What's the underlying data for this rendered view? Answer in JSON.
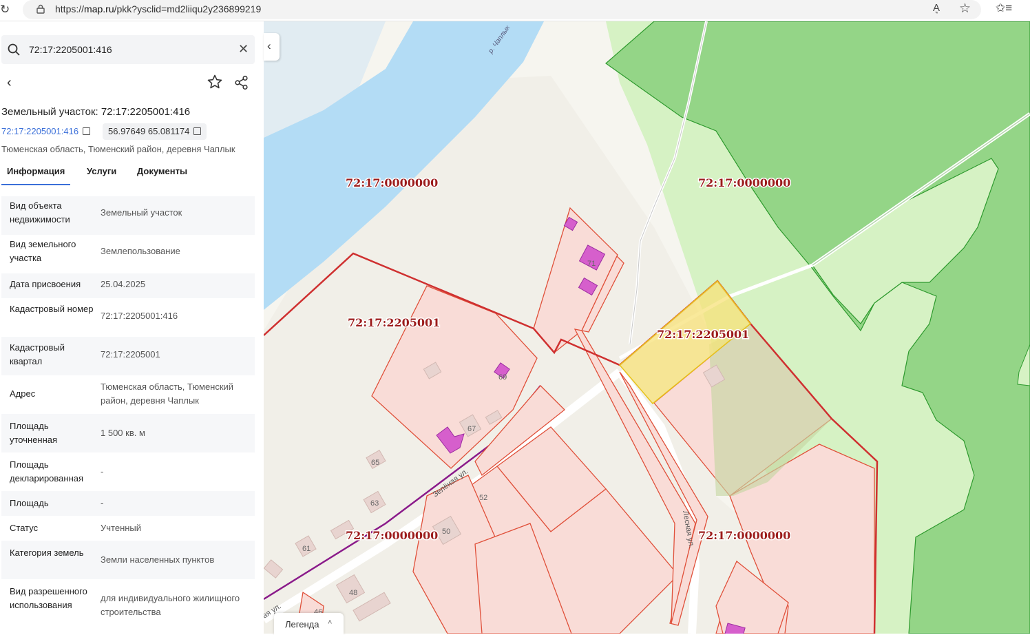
{
  "browser": {
    "url_scheme": "https://",
    "url_host": "map.ru",
    "url_path": "/pkk?ysclid=md2liiqu2y236899219",
    "read_aloud": "A͉",
    "favorite_icon": "☆",
    "favorites_icon": "✩≡"
  },
  "search": {
    "value": "72:17:2205001:416",
    "clear_icon": "✕"
  },
  "panel": {
    "back_icon": "‹",
    "title": "Земельный участок: 72:17:2205001:416",
    "cad_link": "72:17:2205001:416",
    "coords": "56.97649 65.081174",
    "address": "Тюменская область, Тюменский район, деревня Чаплык"
  },
  "tabs": [
    "Информация",
    "Услуги",
    "Документы"
  ],
  "rows": [
    {
      "label": "Вид объекта недвижимости",
      "value": "Земельный участок"
    },
    {
      "label": "Вид земельного участка",
      "value": "Землепользование"
    },
    {
      "label": "Дата присвоения",
      "value": "25.04.2025"
    },
    {
      "label": "Кадастровый номер",
      "value": "72:17:2205001:416"
    },
    {
      "label": "Кадастровый квартал",
      "value": "72:17:2205001"
    },
    {
      "label": "Адрес",
      "value": "Тюменская область, Тюменский район, деревня Чаплык"
    },
    {
      "label": "Площадь уточненная",
      "value": "1 500 кв. м"
    },
    {
      "label": "Площадь декларированная",
      "value": "-"
    },
    {
      "label": "Площадь",
      "value": "-"
    },
    {
      "label": "Статус",
      "value": "Учтенный"
    },
    {
      "label": "Категория земель",
      "value": "Земли населенных пунктов"
    },
    {
      "label": "Вид разрешенного использования",
      "value": "для индивидуального жилищного строительства"
    }
  ],
  "map": {
    "collapse_icon": "‹",
    "legend": "Легенда",
    "legend_icon": "˄",
    "quarter_labels": [
      "72:17:0000000",
      "72:17:0000000",
      "72:17:2205001",
      "72:17:2205001",
      "72:17:0000000",
      "72:17:0000000"
    ],
    "house_numbers": [
      "71",
      "69",
      "67",
      "65",
      "63",
      "61",
      "52",
      "50",
      "48",
      "46"
    ],
    "street_labels": [
      "Зелёная ул.",
      "Лесная ул.",
      "ая ул."
    ],
    "river_label": "р. Чаплык",
    "colors": {
      "river": "#b3dcf5",
      "forest": "#94d587",
      "meadow": "#d6f2c4",
      "parcel_fill": "#f9dcd7",
      "parcel_line": "#e0503a",
      "selected": "#f7e27a",
      "label": "#9c1c1c"
    }
  }
}
